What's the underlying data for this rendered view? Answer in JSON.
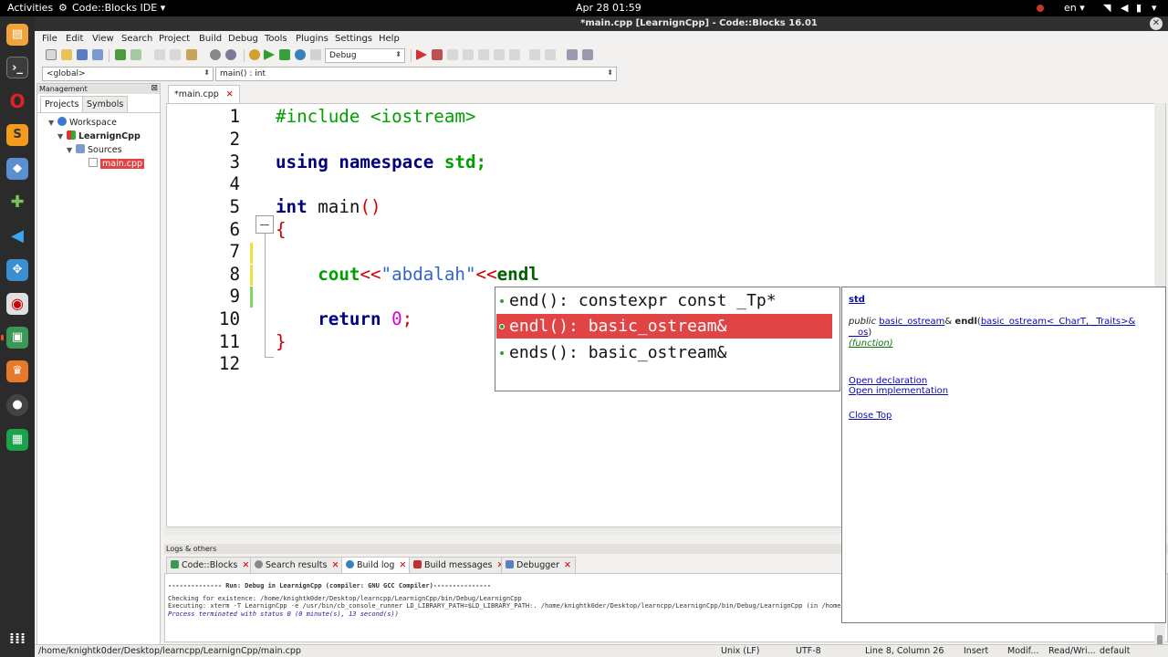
{
  "topbar": {
    "activities": "Activities",
    "app_menu": "Code::Blocks IDE ▾",
    "clock": "Apr 28  01:59",
    "language": "en ▾",
    "system_menu": "▾"
  },
  "window": {
    "title": "*main.cpp [LearnignCpp] - Code::Blocks 16.01"
  },
  "menu": [
    "File",
    "Edit",
    "View",
    "Search",
    "Project",
    "Build",
    "Debug",
    "Tools",
    "Plugins",
    "Settings",
    "Help"
  ],
  "toolbar": {
    "build_target": "Debug"
  },
  "scope": {
    "scope_value": "<global>",
    "function_value": "main() : int"
  },
  "management": {
    "header": "Management",
    "tabs": [
      "Projects",
      "Symbols"
    ],
    "tree": {
      "workspace": "Workspace",
      "project": "LearnignCpp",
      "folder": "Sources",
      "file": "main.cpp"
    }
  },
  "editor": {
    "tab_label": "*main.cpp",
    "line_numbers": [
      "1",
      "2",
      "3",
      "4",
      "5",
      "6",
      "7",
      "8",
      "9",
      "10",
      "11",
      "12"
    ],
    "code": {
      "l1": "#include <iostream>",
      "l3_kw1": "using",
      "l3_kw2": "namespace",
      "l3_rest": "std;",
      "l5_kw": "int",
      "l5_name": "main",
      "l5_parens": "()",
      "l6": "{",
      "l8_id": "cout",
      "l8_op1": "<<",
      "l8_str": "\"abdalah\"",
      "l8_op2": "<<",
      "l8_hl": "endl",
      "l10_kw": "return",
      "l10_num": "0",
      "l10_semi": ";",
      "l11": "}"
    }
  },
  "autocomplete": {
    "items": [
      "end(): constexpr const _Tp*",
      "endl(): basic_ostream&",
      "ends(): basic_ostream&"
    ],
    "selected_index": 1
  },
  "doc_popup": {
    "namespace": "std",
    "sig_public": "public",
    "sig_type": "basic_ostream",
    "sig_amp": "&",
    "sig_name": "endl",
    "sig_paren_open": "(",
    "sig_param": "basic_ostream<_CharT, _Traits>& __os",
    "sig_paren_close": ")",
    "kind": "(function)",
    "open_declaration": "Open declaration",
    "open_implementation": "Open implementation",
    "close_top": "Close Top"
  },
  "logs": {
    "header": "Logs & others",
    "tabs": [
      "Code::Blocks",
      "Search results",
      "Build log",
      "Build messages",
      "Debugger"
    ],
    "active_tab": "Build log",
    "lines": [
      "-------------- Run: Debug in LearnignCpp (compiler: GNU GCC Compiler)---------------",
      "Checking for existence: /home/knightk0der/Desktop/learncpp/LearnignCpp/bin/Debug/LearnignCpp",
      "Executing: xterm -T LearnignCpp -e /usr/bin/cb_console_runner LD_LIBRARY_PATH=$LD_LIBRARY_PATH:. /home/knightk0der/Desktop/learncpp/LearnignCpp/bin/Debug/LearnignCpp  (in /home/knightk0der/Desktop/learncpp/LearnignCpp/.)",
      "Process terminated with status 0 (0 minute(s), 13 second(s))"
    ]
  },
  "status": {
    "path": "/home/knightk0der/Desktop/learncpp/LearnignCpp/main.cpp",
    "eol": "Unix (LF)",
    "encoding": "UTF-8",
    "position": "Line 8, Column 26",
    "mode": "Insert",
    "modified": "Modif...",
    "access": "Read/Wri...",
    "profile": "default"
  },
  "colors": {
    "accent": "#e04444",
    "dock_bg": "#2b2b2b",
    "keyword": "#00007f",
    "preprocessor": "#00a000"
  }
}
